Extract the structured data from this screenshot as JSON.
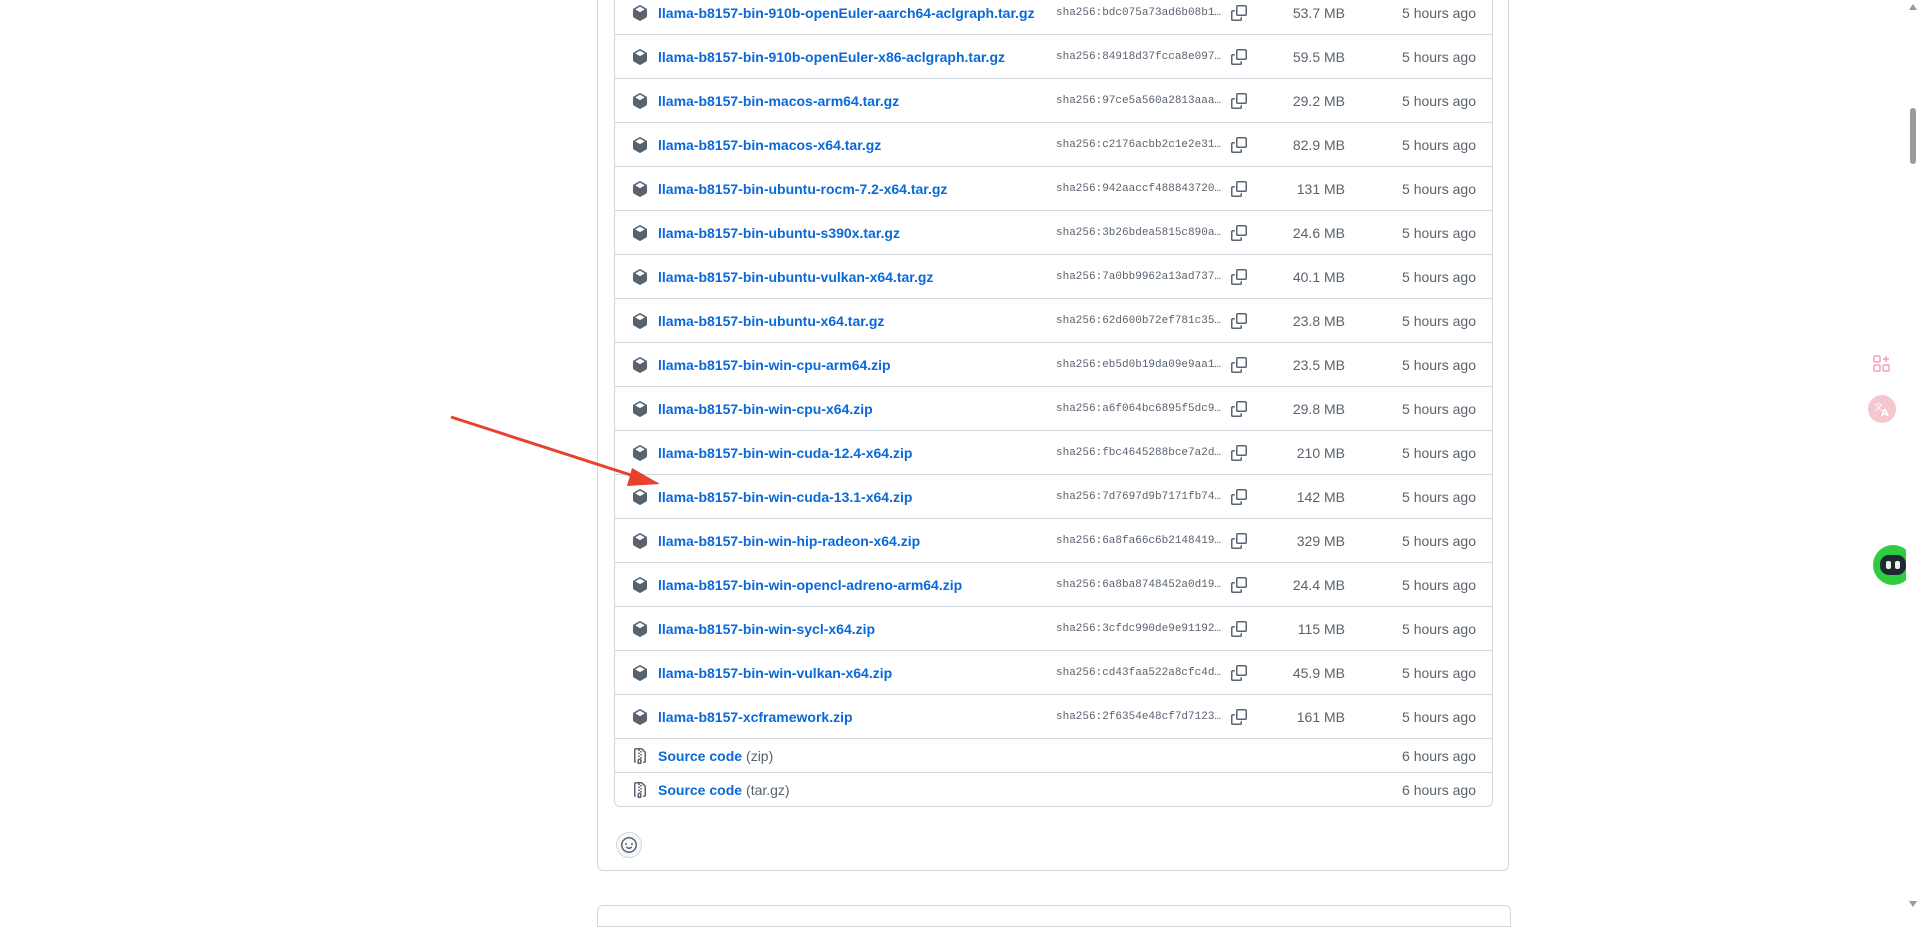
{
  "assets": [
    {
      "name": "llama-b8157-bin-910b-openEuler-aarch64-aclgraph.tar.gz",
      "sha": "sha256:bdc075a73ad6b08b1…",
      "size": "53.7 MB",
      "age": "5 hours ago"
    },
    {
      "name": "llama-b8157-bin-910b-openEuler-x86-aclgraph.tar.gz",
      "sha": "sha256:84918d37fcca8e097…",
      "size": "59.5 MB",
      "age": "5 hours ago"
    },
    {
      "name": "llama-b8157-bin-macos-arm64.tar.gz",
      "sha": "sha256:97ce5a560a2813aaa…",
      "size": "29.2 MB",
      "age": "5 hours ago"
    },
    {
      "name": "llama-b8157-bin-macos-x64.tar.gz",
      "sha": "sha256:c2176acbb2c1e2e31…",
      "size": "82.9 MB",
      "age": "5 hours ago"
    },
    {
      "name": "llama-b8157-bin-ubuntu-rocm-7.2-x64.tar.gz",
      "sha": "sha256:942aaccf488843720…",
      "size": "131 MB",
      "age": "5 hours ago"
    },
    {
      "name": "llama-b8157-bin-ubuntu-s390x.tar.gz",
      "sha": "sha256:3b26bdea5815c890a…",
      "size": "24.6 MB",
      "age": "5 hours ago"
    },
    {
      "name": "llama-b8157-bin-ubuntu-vulkan-x64.tar.gz",
      "sha": "sha256:7a0bb9962a13ad737…",
      "size": "40.1 MB",
      "age": "5 hours ago"
    },
    {
      "name": "llama-b8157-bin-ubuntu-x64.tar.gz",
      "sha": "sha256:62d600b72ef781c35…",
      "size": "23.8 MB",
      "age": "5 hours ago"
    },
    {
      "name": "llama-b8157-bin-win-cpu-arm64.zip",
      "sha": "sha256:eb5d0b19da09e9aa1…",
      "size": "23.5 MB",
      "age": "5 hours ago"
    },
    {
      "name": "llama-b8157-bin-win-cpu-x64.zip",
      "sha": "sha256:a6f064bc6895f5dc9…",
      "size": "29.8 MB",
      "age": "5 hours ago"
    },
    {
      "name": "llama-b8157-bin-win-cuda-12.4-x64.zip",
      "sha": "sha256:fbc4645288bce7a2d…",
      "size": "210 MB",
      "age": "5 hours ago"
    },
    {
      "name": "llama-b8157-bin-win-cuda-13.1-x64.zip",
      "sha": "sha256:7d7697d9b7171fb74…",
      "size": "142 MB",
      "age": "5 hours ago"
    },
    {
      "name": "llama-b8157-bin-win-hip-radeon-x64.zip",
      "sha": "sha256:6a8fa66c6b2148419…",
      "size": "329 MB",
      "age": "5 hours ago"
    },
    {
      "name": "llama-b8157-bin-win-opencl-adreno-arm64.zip",
      "sha": "sha256:6a8ba8748452a0d19…",
      "size": "24.4 MB",
      "age": "5 hours ago"
    },
    {
      "name": "llama-b8157-bin-win-sycl-x64.zip",
      "sha": "sha256:3cfdc990de9e91192…",
      "size": "115 MB",
      "age": "5 hours ago"
    },
    {
      "name": "llama-b8157-bin-win-vulkan-x64.zip",
      "sha": "sha256:cd43faa522a8cfc4d…",
      "size": "45.9 MB",
      "age": "5 hours ago"
    },
    {
      "name": "llama-b8157-xcframework.zip",
      "sha": "sha256:2f6354e48cf7d7123…",
      "size": "161 MB",
      "age": "5 hours ago"
    }
  ],
  "source": [
    {
      "label": "Source code",
      "format": "(zip)",
      "age": "6 hours ago"
    },
    {
      "label": "Source code",
      "format": "(tar.gz)",
      "age": "6 hours ago"
    }
  ],
  "icons": {
    "package": "package-icon",
    "zip": "file-zip-icon",
    "copy": "copy-icon",
    "reaction": "smiley-icon",
    "apps": "apps-plus-icon",
    "translate": "translate-icon",
    "assistant": "robot-icon"
  },
  "colors": {
    "link": "#0969da",
    "muted": "#59636e",
    "border": "#d1d9e0",
    "annotation_arrow": "#e8412c",
    "assistant_bg": "#2ecc40"
  }
}
